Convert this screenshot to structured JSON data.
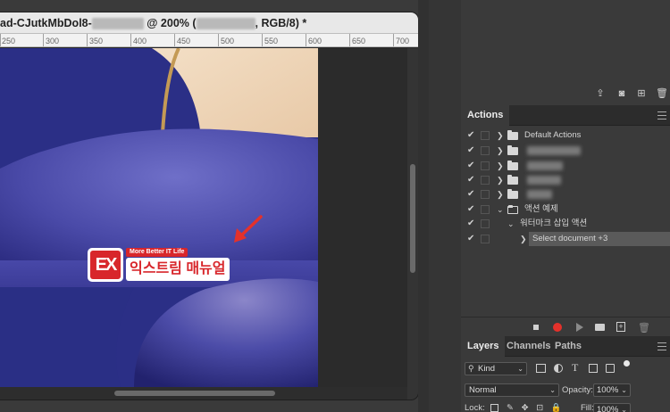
{
  "document": {
    "title_prefix": "ad-CJutkMbDol8-",
    "title_zoom": "@ 200% (",
    "title_mode": ", RGB/8) *",
    "ruler_ticks": [
      "250",
      "300",
      "350",
      "400",
      "450",
      "500",
      "550",
      "600",
      "650",
      "700"
    ]
  },
  "watermark": {
    "tagline": "More Better IT Life",
    "brand": "익스트림 매뉴얼",
    "logo_letters": "EX"
  },
  "actions_panel": {
    "tab": "Actions",
    "rows": [
      {
        "label": "Default Actions"
      },
      {
        "label": ""
      },
      {
        "label": ""
      },
      {
        "label": ""
      },
      {
        "label": ""
      },
      {
        "label": "액션 예제"
      },
      {
        "label": "워터마크 삽입 액션"
      },
      {
        "label": "Select document +3"
      }
    ]
  },
  "layers_panel": {
    "tabs": [
      "Layers",
      "Channels",
      "Paths"
    ],
    "kind": "Kind",
    "blend_mode": "Normal",
    "opacity_label": "Opacity:",
    "opacity_value": "100%",
    "lock_label": "Lock:",
    "fill_label": "Fill:",
    "fill_value": "100%"
  },
  "colors": {
    "accent_red": "#e4312b",
    "canvas_blue": "#3f3fa0"
  }
}
